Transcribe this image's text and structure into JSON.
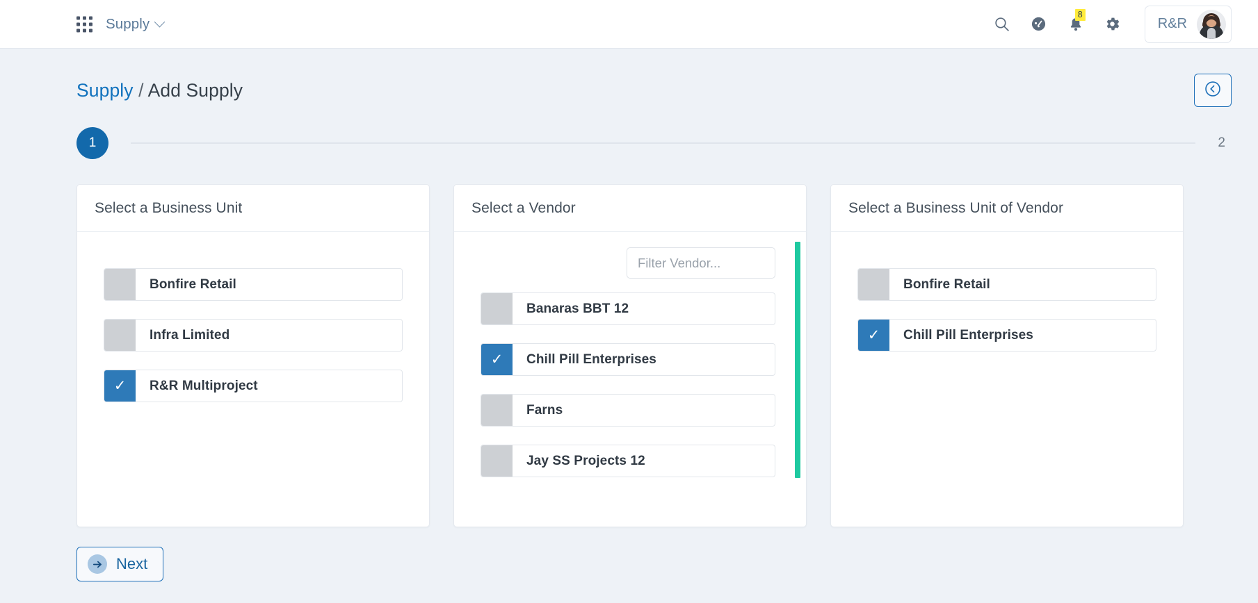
{
  "topbar": {
    "app_launcher_icon": "grid-apps-icon",
    "brand": "Supply",
    "brand_caret_icon": "chevron-down-icon",
    "icons": [
      {
        "name": "search-icon"
      },
      {
        "name": "dashboard-gauge-icon"
      },
      {
        "name": "notifications-bell-icon",
        "badge": "8"
      },
      {
        "name": "settings-gear-icon"
      }
    ],
    "user": {
      "name": "R&R",
      "avatar_icon": "user-avatar-photo"
    }
  },
  "breadcrumb": {
    "root": "Supply",
    "separator": "/",
    "current": "Add Supply"
  },
  "back_button": {
    "icon": "circle-chevron-left-icon"
  },
  "stepper": {
    "step1": "1",
    "step2": "2"
  },
  "panels": [
    {
      "title": "Select a Business Unit",
      "has_filter": false,
      "options": [
        {
          "label": "Bonfire Retail",
          "selected": false
        },
        {
          "label": "Infra Limited",
          "selected": false
        },
        {
          "label": "R&R Multiproject",
          "selected": true
        }
      ]
    },
    {
      "title": "Select a Vendor",
      "has_filter": true,
      "filter_placeholder": "Filter Vendor...",
      "filter_value": "",
      "options": [
        {
          "label": "Banaras BBT 12",
          "selected": false
        },
        {
          "label": "Chill Pill Enterprises",
          "selected": true
        },
        {
          "label": "Farns",
          "selected": false
        },
        {
          "label": "Jay SS Projects 12",
          "selected": false
        }
      ]
    },
    {
      "title": "Select a Business Unit of Vendor",
      "has_filter": false,
      "options": [
        {
          "label": "Bonfire Retail",
          "selected": false
        },
        {
          "label": "Chill Pill Enterprises",
          "selected": true
        }
      ]
    }
  ],
  "footer": {
    "next_label": "Next",
    "next_icon": "circle-arrow-right-icon"
  },
  "checkmark_glyph": "✓",
  "colors": {
    "accent_blue": "#1369ab",
    "selected_blue": "#2e7ab8",
    "scrollbar_green": "#1ec9a0",
    "badge_yellow": "#ffeb3b",
    "page_bg": "#eef2f7"
  }
}
